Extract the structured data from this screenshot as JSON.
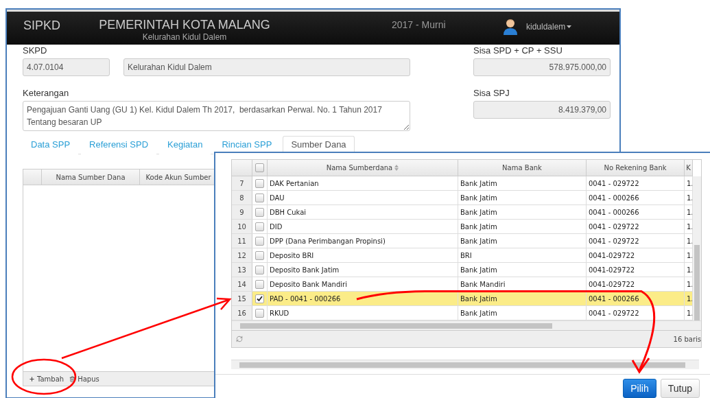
{
  "header": {
    "brand": "SIPKD",
    "title": "PEMERINTAH KOTA MALANG",
    "subtitle": "Kelurahan Kidul Dalem",
    "period": "2017 - Murni",
    "user": "kiduldalem"
  },
  "form": {
    "skpd_label": "SKPD",
    "skpd_code": "4.07.0104",
    "skpd_name": "Kelurahan Kidul Dalem",
    "keterangan_label": "Keterangan",
    "keterangan": "Pengajuan Ganti Uang (GU 1) Kel. Kidul Dalem Th 2017,  berdasarkan Perwal. No. 1 Tahun 2017 Tentang besaran UP",
    "sisa_spd_label": "Sisa SPD + CP + SSU",
    "sisa_spd": "578.975.000,00",
    "sisa_spj_label": "Sisa SPJ",
    "sisa_spj": "8.419.379,00"
  },
  "tabs": [
    {
      "label": "Data SPP",
      "selected": false
    },
    {
      "label": "Referensi SPD",
      "selected": false
    },
    {
      "label": "Kegiatan",
      "selected": false
    },
    {
      "label": "Rincian SPP",
      "selected": false
    },
    {
      "label": "Sumber Dana",
      "selected": true
    }
  ],
  "grid": {
    "columns": [
      "Nama Sumber Dana",
      "Kode Akun Sumber"
    ],
    "actions": [
      "Tambah",
      "Hapus"
    ]
  },
  "dialog": {
    "select_all_checked": false,
    "columns": [
      "Nama Sumberdana",
      "Nama Bank",
      "No Rekening Bank",
      "K"
    ],
    "rows": [
      {
        "no": "7",
        "checked": false,
        "selected": false,
        "name": "DAK Pertanian",
        "bank": "Bank Jatim",
        "account": "0041 - 029722",
        "column_4": "1."
      },
      {
        "no": "8",
        "checked": false,
        "selected": false,
        "name": "DAU",
        "bank": "Bank Jatim",
        "account": "0041 - 000266",
        "column_4": "1."
      },
      {
        "no": "9",
        "checked": false,
        "selected": false,
        "name": "DBH Cukai",
        "bank": "Bank Jatim",
        "account": "0041 - 000266",
        "column_4": "1."
      },
      {
        "no": "10",
        "checked": false,
        "selected": false,
        "name": "DID",
        "bank": "Bank Jatim",
        "account": "0041 - 029722",
        "column_4": "1."
      },
      {
        "no": "11",
        "checked": false,
        "selected": false,
        "name": "DPP (Dana Perimbangan Propinsi)",
        "bank": "Bank Jatim",
        "account": "0041 - 029722",
        "column_4": "1."
      },
      {
        "no": "12",
        "checked": false,
        "selected": false,
        "name": "Deposito BRI",
        "bank": "BRI",
        "account": "0041-029722",
        "column_4": "1."
      },
      {
        "no": "13",
        "checked": false,
        "selected": false,
        "name": "Deposito Bank Jatim",
        "bank": "Bank Jatim",
        "account": "0041-029722",
        "column_4": "1."
      },
      {
        "no": "14",
        "checked": false,
        "selected": false,
        "name": "Deposito Bank Mandiri",
        "bank": "Bank Mandiri",
        "account": "0041-029722",
        "column_4": "1."
      },
      {
        "no": "15",
        "checked": true,
        "selected": true,
        "name": "PAD - 0041 - 000266",
        "bank": "Bank Jatim",
        "account": "0041 - 000266",
        "column_4": "1."
      },
      {
        "no": "16",
        "checked": false,
        "selected": false,
        "name": "RKUD",
        "bank": "Bank Jatim",
        "account": "0041 - 029722",
        "column_4": "1."
      }
    ],
    "footer": "16 baris",
    "buttons": [
      {
        "label": "Pilih",
        "kind": "primary"
      },
      {
        "label": "Tutup",
        "kind": "default"
      }
    ]
  }
}
